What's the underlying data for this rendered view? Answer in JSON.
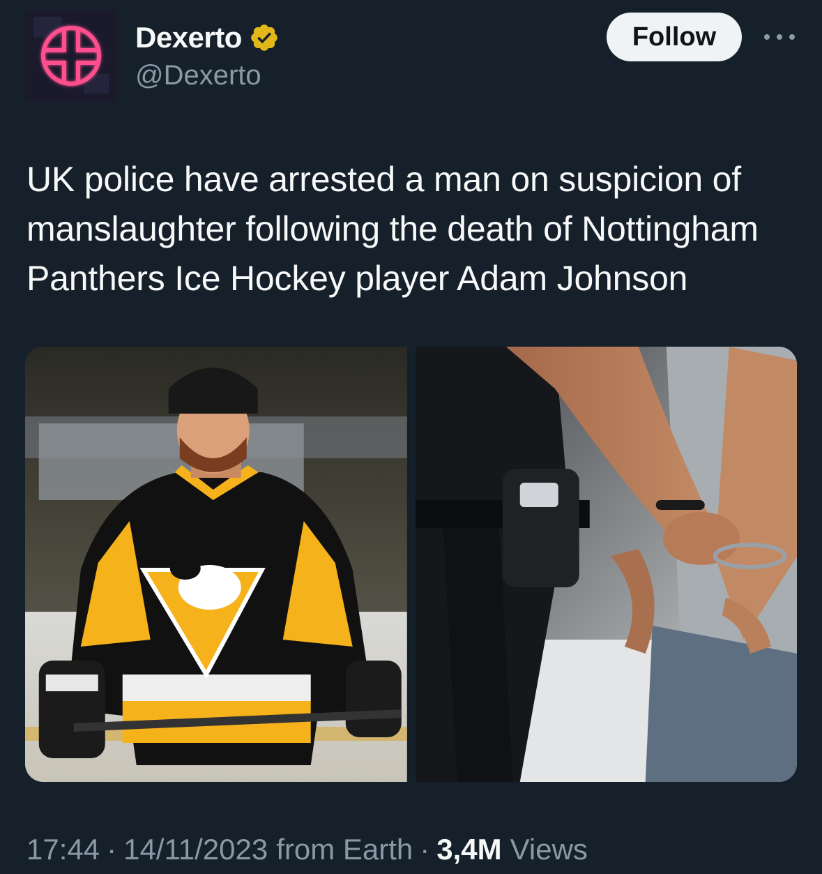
{
  "author": {
    "display_name": "Dexerto",
    "handle": "@Dexerto",
    "verified_badge_color": "#e2b719",
    "avatar_accent_color": "#ff3d7f"
  },
  "actions": {
    "follow_label": "Follow",
    "more_icon": "more-horizontal-icon"
  },
  "tweet": {
    "text": "UK police have arrested a man on suspicion of manslaughter following the death of Nottingham Panthers Ice Hockey player Adam Johnson",
    "media": [
      {
        "description_icon": "hockey-player-photo"
      },
      {
        "description_icon": "handcuffs-arrest-photo"
      }
    ]
  },
  "footer": {
    "time": "17:44",
    "date": "14/11/2023",
    "source": "from Earth",
    "views_count": "3,4M",
    "views_label": "Views",
    "separator": "·"
  },
  "colors": {
    "background": "#15202b",
    "primary_text": "#f7f9f9",
    "secondary_text": "#8b98a5",
    "follow_bg": "#eff3f4"
  }
}
